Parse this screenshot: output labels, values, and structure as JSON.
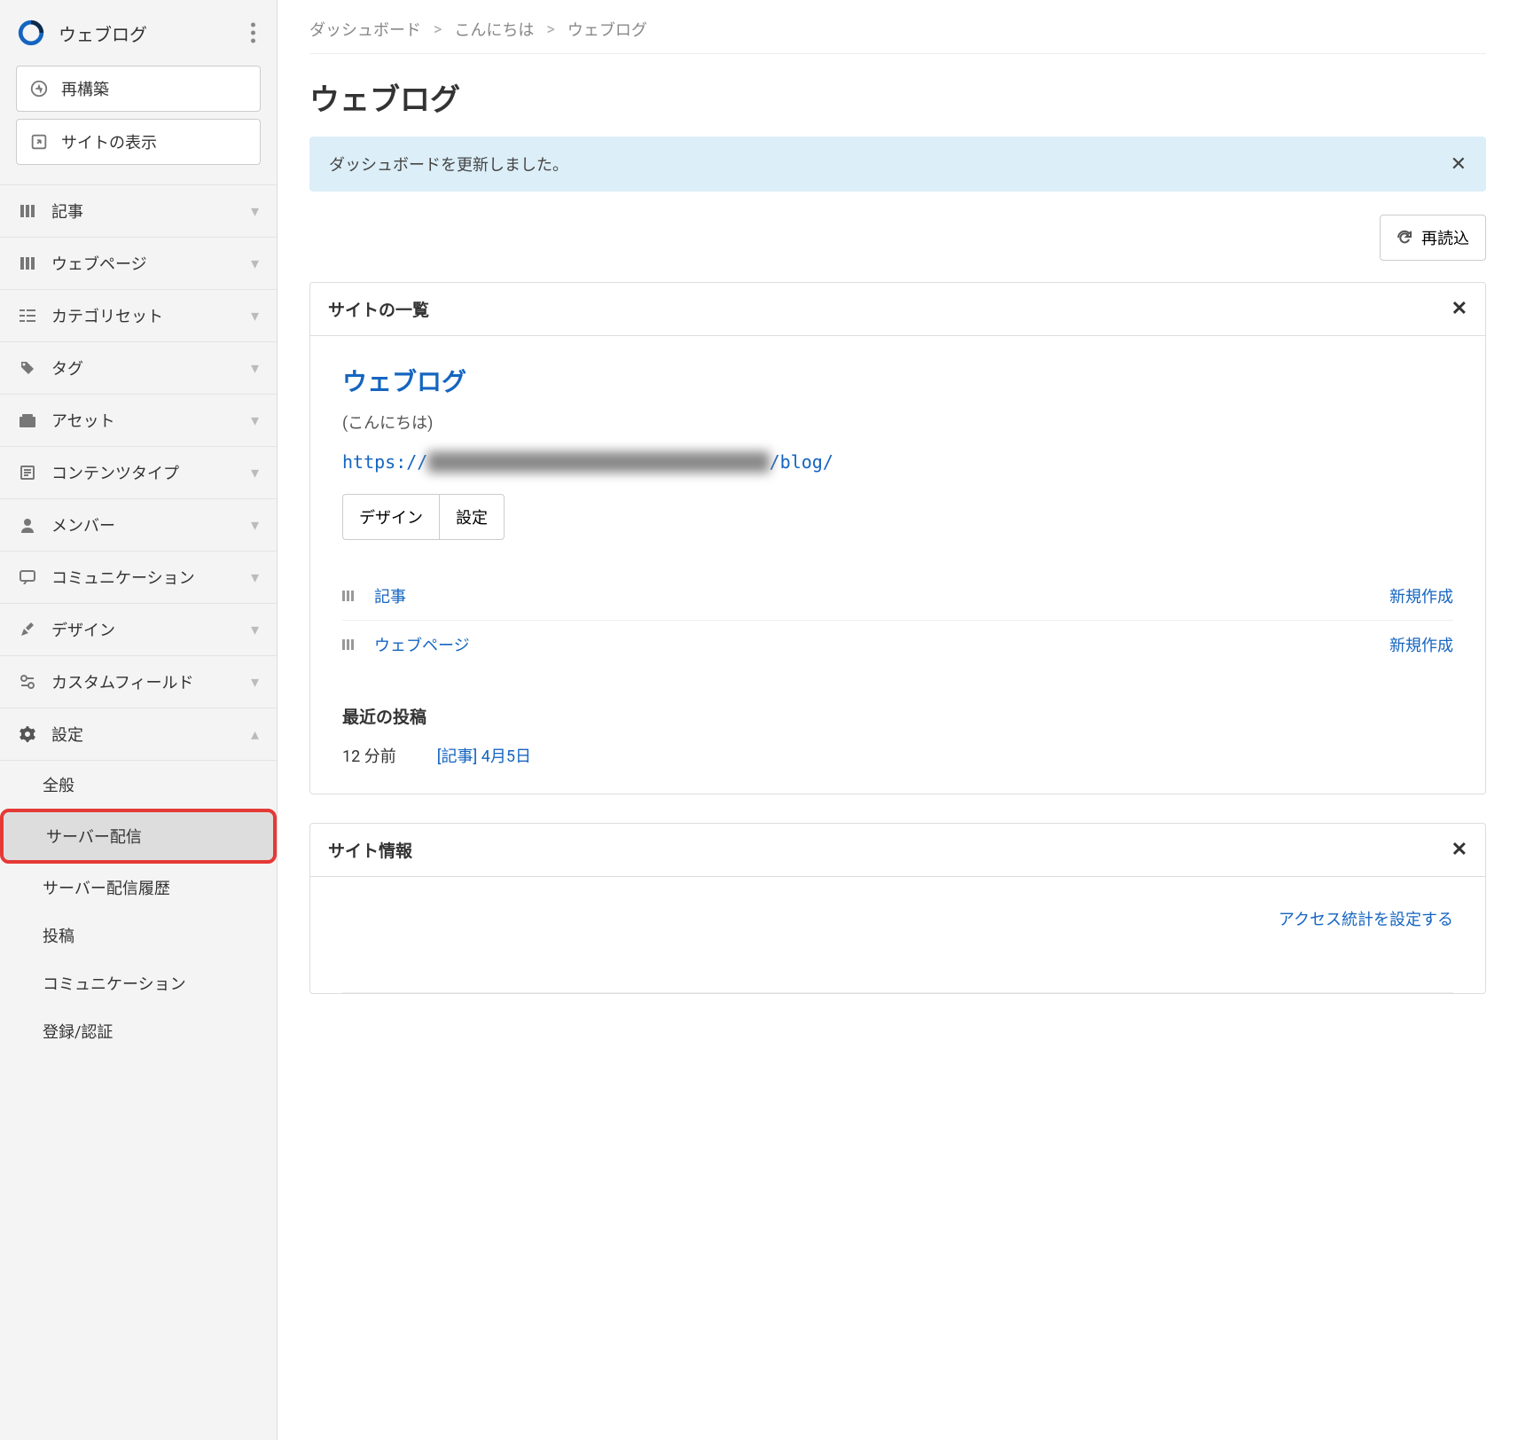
{
  "sidebar": {
    "site_name": "ウェブログ",
    "rebuild_label": "再構築",
    "view_site_label": "サイトの表示",
    "nav": [
      {
        "label": "記事",
        "icon": "grid"
      },
      {
        "label": "ウェブページ",
        "icon": "grid"
      },
      {
        "label": "カテゴリセット",
        "icon": "category"
      },
      {
        "label": "タグ",
        "icon": "tag"
      },
      {
        "label": "アセット",
        "icon": "asset"
      },
      {
        "label": "コンテンツタイプ",
        "icon": "content-type"
      },
      {
        "label": "メンバー",
        "icon": "member"
      },
      {
        "label": "コミュニケーション",
        "icon": "communication"
      },
      {
        "label": "デザイン",
        "icon": "design"
      },
      {
        "label": "カスタムフィールド",
        "icon": "custom-field"
      },
      {
        "label": "設定",
        "icon": "settings",
        "expanded": true
      }
    ],
    "settings_sub": [
      {
        "label": "全般"
      },
      {
        "label": "サーバー配信",
        "active": true,
        "highlighted": true
      },
      {
        "label": "サーバー配信履歴"
      },
      {
        "label": "投稿"
      },
      {
        "label": "コミュニケーション"
      },
      {
        "label": "登録/認証"
      }
    ]
  },
  "breadcrumb": [
    "ダッシュボード",
    "こんにちは",
    "ウェブログ"
  ],
  "page_title": "ウェブログ",
  "alert_message": "ダッシュボードを更新しました。",
  "reload_label": "再読込",
  "site_list": {
    "header": "サイトの一覧",
    "site_title": "ウェブログ",
    "site_sub": "(こんにちは)",
    "url_prefix": "https://",
    "url_hidden": "████████████████████████████████",
    "url_suffix": "/blog/",
    "design_btn": "デザイン",
    "settings_btn": "設定",
    "content_rows": [
      {
        "label": "記事",
        "action": "新規作成"
      },
      {
        "label": "ウェブページ",
        "action": "新規作成"
      }
    ],
    "recent_title": "最近の投稿",
    "recent_time": "12 分前",
    "recent_label": "[記事] 4月5日"
  },
  "site_info": {
    "header": "サイト情報",
    "stats_link": "アクセス統計を設定する"
  }
}
